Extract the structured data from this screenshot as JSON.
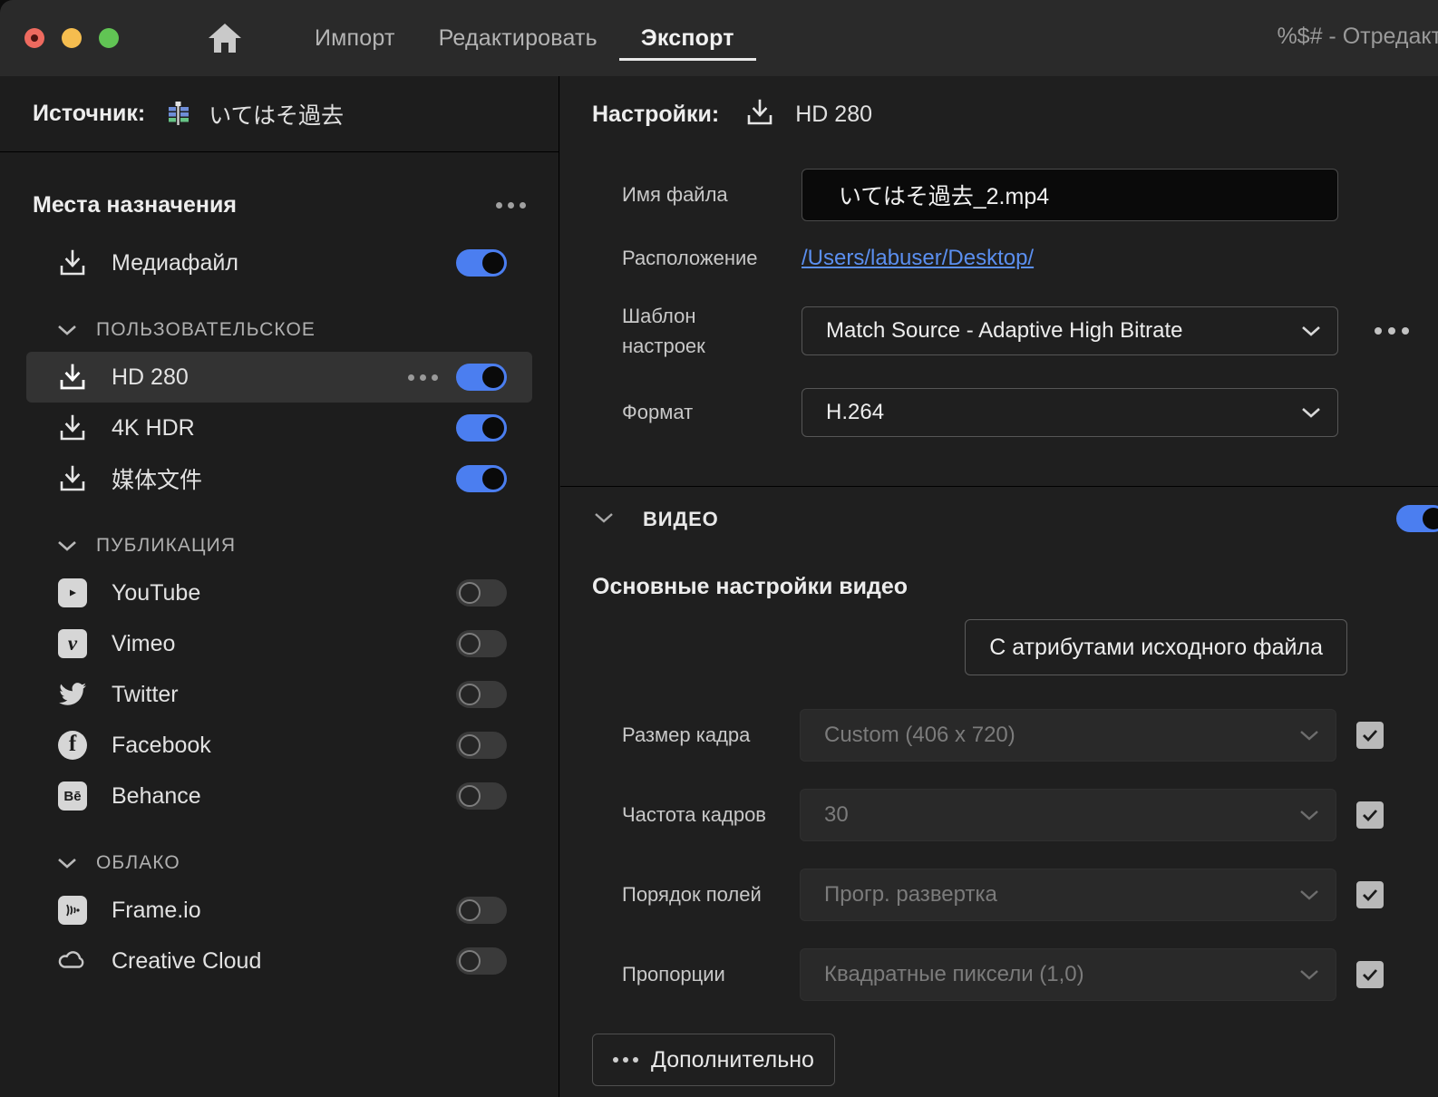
{
  "titlebar": {
    "home_icon": "home-icon",
    "tabs": [
      {
        "label": "Импорт",
        "active": false
      },
      {
        "label": "Редактировать",
        "active": false
      },
      {
        "label": "Экспорт",
        "active": true
      }
    ],
    "window_title": "%$# - Отредакти"
  },
  "left_panel": {
    "source_label": "Источник:",
    "source_icon": "sequence-timeline-icon",
    "source_name": "いてはそ過去",
    "destinations_title": "Места назначения",
    "destinations_menu_icon": "more-options-icon",
    "media_file": {
      "label": "Медиафайл",
      "icon": "export-download-icon",
      "enabled": true
    },
    "groups": [
      {
        "name": "ПОЛЬЗОВАТЕЛЬСКОЕ",
        "expanded": true
      },
      {
        "name": "ПУБЛИКАЦИЯ",
        "expanded": true
      },
      {
        "name": "ОБЛАКО",
        "expanded": true
      }
    ],
    "custom_items": [
      {
        "label": "HD 280",
        "icon": "export-download-icon",
        "enabled": true,
        "selected": true,
        "has_menu": true
      },
      {
        "label": "4K HDR",
        "icon": "export-download-icon",
        "enabled": true,
        "selected": false,
        "has_menu": false
      },
      {
        "label": "媒体文件",
        "icon": "export-download-icon",
        "enabled": true,
        "selected": false,
        "has_menu": false
      }
    ],
    "publish_items": [
      {
        "label": "YouTube",
        "icon": "youtube-icon",
        "enabled": false
      },
      {
        "label": "Vimeo",
        "icon": "vimeo-icon",
        "enabled": false
      },
      {
        "label": "Twitter",
        "icon": "twitter-icon",
        "enabled": false
      },
      {
        "label": "Facebook",
        "icon": "facebook-icon",
        "enabled": false
      },
      {
        "label": "Behance",
        "icon": "behance-icon",
        "enabled": false
      }
    ],
    "cloud_items": [
      {
        "label": "Frame.io",
        "icon": "frameio-icon",
        "enabled": false
      },
      {
        "label": "Creative Cloud",
        "icon": "creative-cloud-icon",
        "enabled": false
      }
    ]
  },
  "right_panel": {
    "settings_label": "Настройки:",
    "settings_icon": "export-download-icon",
    "settings_preset": "HD 280",
    "filename_label": "Имя файла",
    "filename_value": "いてはそ過去_2.mp4",
    "location_label": "Расположение",
    "location_value": "/Users/labuser/Desktop/",
    "preset_label": "Шаблон настроек",
    "preset_label_line1": "Шаблон",
    "preset_label_line2": "настроек",
    "preset_value": "Match Source - Adaptive High Bitrate",
    "preset_menu_icon": "more-options-icon",
    "format_label": "Формат",
    "format_value": "H.264",
    "video": {
      "section_title": "ВИДЕО",
      "section_enabled": true,
      "basic_title": "Основные настройки видео",
      "match_source_button": "С атрибутами исходного файла",
      "rows": [
        {
          "label": "Размер кадра",
          "value": "Custom (406 x 720)",
          "disabled": true,
          "checked": true
        },
        {
          "label": "Частота кадров",
          "value": "30",
          "disabled": true,
          "checked": true
        },
        {
          "label": "Порядок полей",
          "value": "Прогр. развертка",
          "disabled": true,
          "checked": true
        },
        {
          "label": "Пропорции",
          "value": "Квадратные пиксели (1,0)",
          "disabled": true,
          "checked": true
        }
      ],
      "more_button": "Дополнительно"
    }
  },
  "colors": {
    "accent_blue": "#4b7ef0",
    "link_blue": "#5b8ff0",
    "panel_bg": "#1f1f1f",
    "sidebar_bg": "#1d1d1d",
    "titlebar_bg": "#2a2a2a",
    "selected_row": "#333333"
  }
}
